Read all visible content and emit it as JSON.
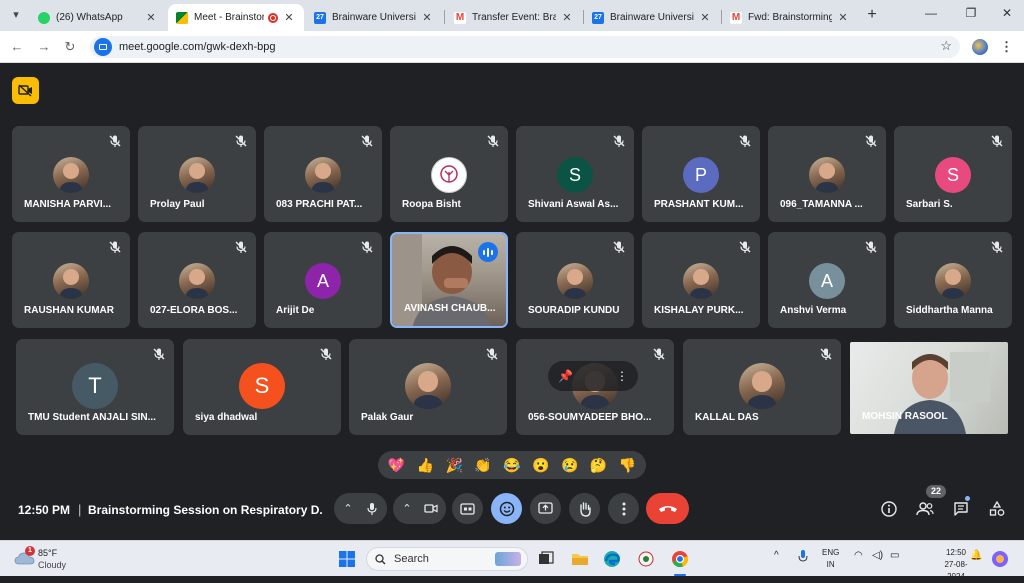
{
  "browser": {
    "tabs": [
      {
        "title": "(26) WhatsApp",
        "favicon": "whatsapp-icon"
      },
      {
        "title": "Meet - Brainstorm",
        "favicon": "meet-icon",
        "active": true
      },
      {
        "title": "Brainware University",
        "favicon": "calendar-icon"
      },
      {
        "title": "Transfer Event: Brains",
        "favicon": "gmail-icon"
      },
      {
        "title": "Brainware University",
        "favicon": "calendar-icon"
      },
      {
        "title": "Fwd: Brainstorming C",
        "favicon": "gmail-icon"
      }
    ],
    "url": "meet.google.com/gwk-dexh-bpg"
  },
  "meet": {
    "participants": [
      {
        "name": "MANISHA PARVI...",
        "avatar": "photo"
      },
      {
        "name": "Prolay Paul",
        "avatar": "photo"
      },
      {
        "name": "083 PRACHI PAT...",
        "avatar": "photo"
      },
      {
        "name": "Roopa Bisht",
        "avatar": "photo"
      },
      {
        "name": "Shivani Aswal As...",
        "initial": "S",
        "color": "#0b5345"
      },
      {
        "name": "PRASHANT KUM...",
        "initial": "P",
        "color": "#5b6bc0"
      },
      {
        "name": "096_TAMANNA ...",
        "avatar": "photo"
      },
      {
        "name": "Sarbari S.",
        "initial": "S",
        "color": "#e84a7f"
      },
      {
        "name": "RAUSHAN KUMAR",
        "avatar": "photo"
      },
      {
        "name": "027-ELORA BOS...",
        "avatar": "photo"
      },
      {
        "name": "Arijit De",
        "initial": "A",
        "color": "#8e24aa"
      },
      {
        "name": "AVINASH CHAUB...",
        "video": true,
        "speaking": true
      },
      {
        "name": "SOURADIP KUNDU",
        "avatar": "photo"
      },
      {
        "name": "KISHALAY PURK...",
        "avatar": "photo"
      },
      {
        "name": "Anshvi Verma",
        "initial": "A",
        "color": "#78909c"
      },
      {
        "name": "Siddhartha Manna",
        "avatar": "photo"
      },
      {
        "name": "TMU Student ANJALI SIN...",
        "initial": "T",
        "color": "#455a64"
      },
      {
        "name": "siya dhadwal",
        "initial": "S",
        "color": "#f4511e"
      },
      {
        "name": "Palak Gaur",
        "avatar": "photo"
      },
      {
        "name": "056-SOUMYADEEP BHO...",
        "avatar": "photo"
      },
      {
        "name": "KALLAL DAS",
        "avatar": "photo"
      },
      {
        "name": "MOHSIN RASOOL",
        "video": true
      }
    ],
    "reactions": [
      "💖",
      "👍",
      "🎉",
      "👏",
      "😂",
      "😮",
      "😢",
      "🤔",
      "👎"
    ],
    "clock": "12:50 PM",
    "separator": "|",
    "meeting_title": "Brainstorming Session on Respiratory D...",
    "people_count": "22"
  },
  "taskbar": {
    "weather_temp": "85°F",
    "weather_cond": "Cloudy",
    "weather_badge": "1",
    "search_label": "Search",
    "lang_line1": "ENG",
    "lang_line2": "IN",
    "time": "12:50",
    "date": "27-08-2024"
  },
  "colors": {
    "meet_bg": "#202124",
    "tile_bg": "#3c4043",
    "end_call": "#ea4335",
    "accent": "#8ab4f8"
  }
}
